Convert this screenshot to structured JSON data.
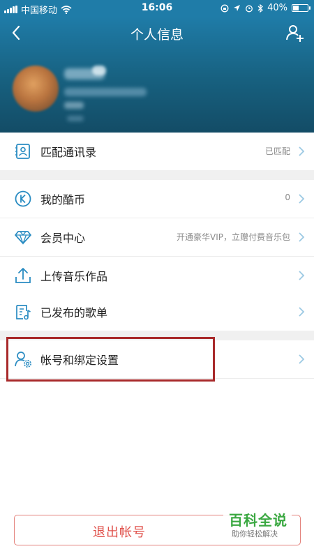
{
  "status_bar": {
    "carrier": "中国移动",
    "time": "16:06",
    "battery_text": "40%",
    "battery_level": 0.4
  },
  "header": {
    "title": "个人信息",
    "back_icon": "chevron-left-icon",
    "add_icon": "add-friend-icon"
  },
  "menu": {
    "contacts": {
      "label": "匹配通讯录",
      "value": "已匹配",
      "icon": "contacts-icon"
    },
    "coins": {
      "label": "我的酷币",
      "value": "0",
      "icon": "coin-icon"
    },
    "vip": {
      "label": "会员中心",
      "value": "开通豪华VIP，立赠付费音乐包",
      "icon": "diamond-icon"
    },
    "upload": {
      "label": "上传音乐作品",
      "value": "",
      "icon": "upload-icon"
    },
    "playlists": {
      "label": "已发布的歌单",
      "value": "",
      "icon": "playlist-icon"
    },
    "account": {
      "label": "帐号和绑定设置",
      "value": "",
      "icon": "account-settings-icon"
    }
  },
  "logout": {
    "label": "退出帐号"
  },
  "watermark": {
    "title": "百科全说",
    "subtitle": "助你轻松解决"
  },
  "colors": {
    "accent": "#1f7ca8",
    "icon": "#2a8cc2",
    "logout": "#e0514b",
    "highlight": "#a8292a",
    "watermark": "#3aa841"
  }
}
